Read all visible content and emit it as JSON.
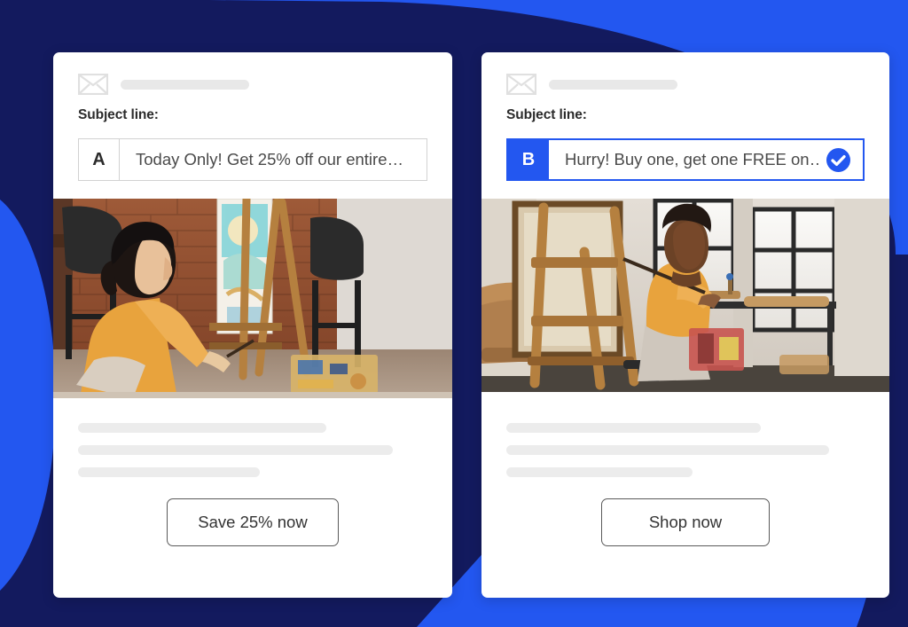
{
  "background": {
    "navy": "#131a5e",
    "blue": "#2357f0"
  },
  "accent": {
    "primary_blue": "#2357f0",
    "border_gray": "#d2d2d2",
    "placeholder_gray": "#e8e8e8"
  },
  "cards": [
    {
      "id": "variant-a",
      "envelope_icon": "envelope-icon",
      "subject_label": "Subject line:",
      "variant_letter": "A",
      "subject_value": "Today Only! Get 25% off our entire…",
      "selected": false,
      "check_icon": null,
      "image": {
        "name": "woman-painting-at-easel-photo",
        "alt": "Woman in orange sweater painting on a canvas at a wooden easel in a brick-walled studio"
      },
      "body_lines": 3,
      "cta_label": "Save 25% now"
    },
    {
      "id": "variant-b",
      "envelope_icon": "envelope-icon",
      "subject_label": "Subject line:",
      "variant_letter": "B",
      "subject_value": "Hurry! Buy one, get one FREE on…",
      "selected": true,
      "check_icon": "check-circle-icon",
      "image": {
        "name": "man-painting-at-easel-photo",
        "alt": "Man in orange sweater painting at a wooden easel in a bright studio with large windows"
      },
      "body_lines": 3,
      "cta_label": "Shop now"
    }
  ]
}
